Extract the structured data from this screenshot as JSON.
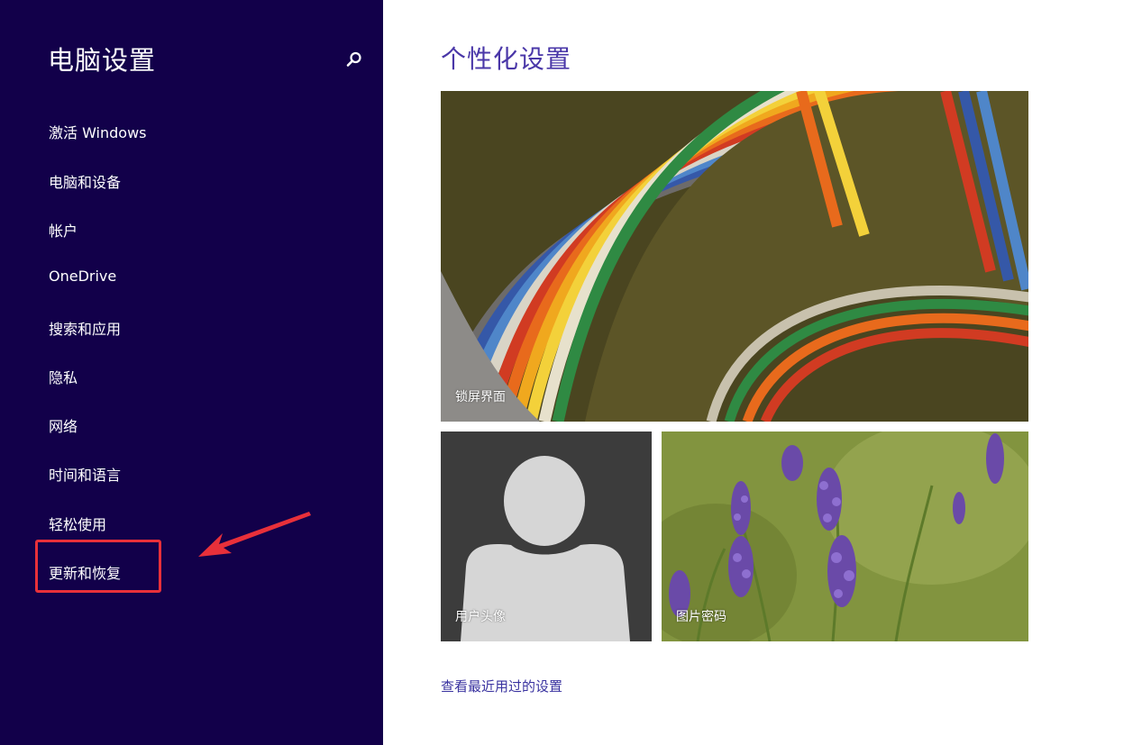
{
  "sidebar": {
    "title": "电脑设置",
    "search_icon": "search-icon",
    "items": [
      {
        "label": "激活 Windows"
      },
      {
        "label": "电脑和设备"
      },
      {
        "label": "帐户"
      },
      {
        "label": "OneDrive"
      },
      {
        "label": "搜索和应用"
      },
      {
        "label": "隐私"
      },
      {
        "label": "网络"
      },
      {
        "label": "时间和语言"
      },
      {
        "label": "轻松使用"
      },
      {
        "label": "更新和恢复"
      }
    ],
    "background_color": "#12004a"
  },
  "main": {
    "title": "个性化设置",
    "title_color": "#4a37a8",
    "tiles": [
      {
        "label": "锁屏界面"
      },
      {
        "label": "用户头像"
      },
      {
        "label": "图片密码"
      }
    ],
    "recent_link": "查看最近用过的设置"
  },
  "annotation": {
    "highlight_color": "#e8303a",
    "arrow_icon": "red-arrow-icon"
  }
}
